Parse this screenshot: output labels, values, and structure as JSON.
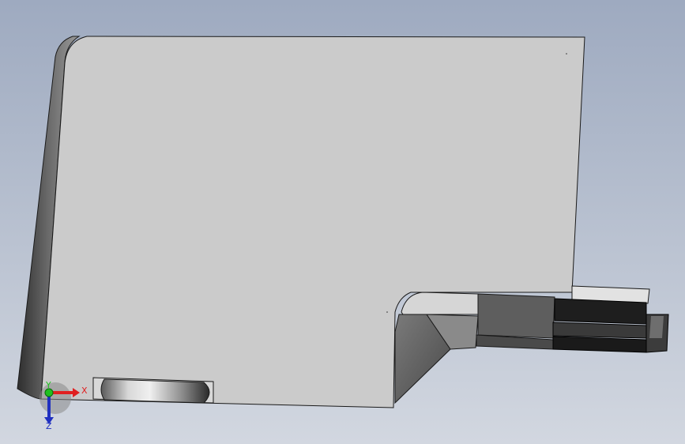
{
  "viewport": {
    "background_top": "#9eaac0",
    "background_bottom": "#d2d7e0"
  },
  "triad": {
    "x_label": "X",
    "y_label": "Y",
    "z_label": "Z",
    "x_color": "#e02020",
    "y_color": "#20c020",
    "z_color": "#2030c0"
  },
  "model": {
    "face_color": "#cbcbcb",
    "side_color": "#4a4a4a",
    "dark_part_color": "#1e1e1e"
  }
}
